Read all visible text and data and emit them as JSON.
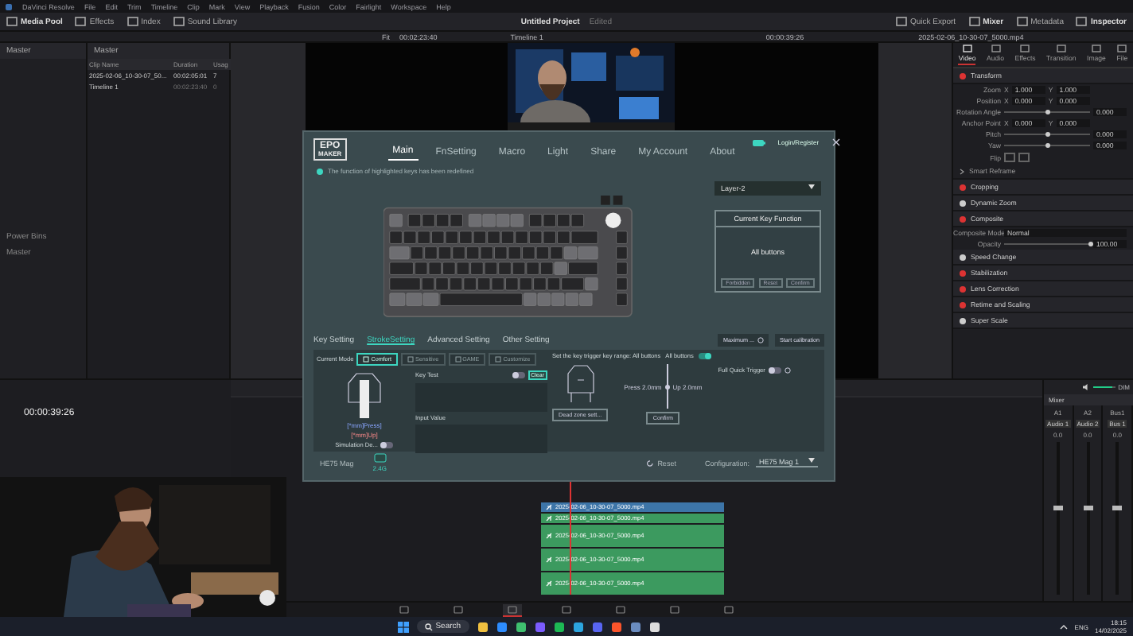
{
  "menubar": {
    "items": [
      "DaVinci Resolve",
      "File",
      "Edit",
      "Trim",
      "Timeline",
      "Clip",
      "Mark",
      "View",
      "Playback",
      "Fusion",
      "Color",
      "Fairlight",
      "Workspace",
      "Help"
    ]
  },
  "toolbar": {
    "left": [
      "Media Pool",
      "Effects",
      "Index",
      "Sound Library"
    ],
    "project": "Untitled Project",
    "project_state": "Edited",
    "right": [
      "Quick Export",
      "Mixer",
      "Metadata",
      "Inspector"
    ]
  },
  "viewer_bar": {
    "zoom": "Fit",
    "source_timecode": "00:02:23:40",
    "timeline": "Timeline 1",
    "timecode": "00:00:39:26",
    "clip": "2025-02-06_10-30-07_5000.mp4"
  },
  "bins": {
    "header": "Master",
    "power_bins": "Power Bins",
    "items": [
      "Master"
    ]
  },
  "media_pool": {
    "title": "Master",
    "columns": [
      "Clip Name",
      "Duration",
      "Usag"
    ],
    "rows": [
      {
        "kind": "clip",
        "cells": [
          "2025-02-06_10-30-07_50...",
          "00:02:05:01",
          "7"
        ]
      },
      {
        "kind": "timeline",
        "cells": [
          "Timeline 1",
          "00:02:23:40",
          "0"
        ]
      }
    ]
  },
  "inspector": {
    "tabs": [
      {
        "label": "Video",
        "selected": true
      },
      {
        "label": "Audio",
        "selected": false
      },
      {
        "label": "Effects",
        "selected": false
      },
      {
        "label": "Transition",
        "selected": false
      },
      {
        "label": "Image",
        "selected": false
      },
      {
        "label": "File",
        "selected": false
      }
    ],
    "sections": [
      {
        "kind": "section",
        "title": "Transform",
        "enabled": true,
        "rows": [
          {
            "kind": "pair",
            "label": "Zoom",
            "fields": [
              {
                "axis": "X",
                "value": "1.000"
              },
              {
                "axis": "Y",
                "value": "1.000"
              }
            ]
          },
          {
            "kind": "pair",
            "label": "Position",
            "fields": [
              {
                "axis": "X",
                "value": "0.000"
              },
              {
                "axis": "Y",
                "value": "0.000"
              }
            ]
          },
          {
            "kind": "slider",
            "label": "Rotation Angle",
            "value": "0.000",
            "level": 0.5
          },
          {
            "kind": "pair",
            "label": "Anchor Point",
            "fields": [
              {
                "axis": "X",
                "value": "0.000"
              },
              {
                "axis": "Y",
                "value": "0.000"
              }
            ]
          },
          {
            "kind": "slider",
            "label": "Pitch",
            "value": "0.000",
            "level": 0.5
          },
          {
            "kind": "slider",
            "label": "Yaw",
            "value": "0.000",
            "level": 0.5
          },
          {
            "kind": "flip",
            "label": "Flip"
          }
        ]
      },
      {
        "kind": "subsection",
        "title": "Smart Reframe"
      },
      {
        "kind": "section",
        "title": "Cropping",
        "enabled": true
      },
      {
        "kind": "section",
        "title": "Dynamic Zoom",
        "enabled": false
      },
      {
        "kind": "section",
        "title": "Composite",
        "enabled": true,
        "rows": [
          {
            "kind": "select",
            "label": "Composite Mode",
            "value": "Normal"
          },
          {
            "kind": "slider",
            "label": "Opacity",
            "value": "100.00",
            "level": 1
          }
        ]
      },
      {
        "kind": "section",
        "title": "Speed Change",
        "enabled": false
      },
      {
        "kind": "section",
        "title": "Stabilization",
        "enabled": true
      },
      {
        "kind": "section",
        "title": "Lens Correction",
        "enabled": true
      },
      {
        "kind": "section",
        "title": "Retime and Scaling",
        "enabled": true
      },
      {
        "kind": "section",
        "title": "Super Scale",
        "enabled": false
      }
    ]
  },
  "timeline": {
    "timecode": "00:00:39:26",
    "clips": [
      {
        "kind": "video",
        "name": "2025-02-06_10-30-07_5000.mp4",
        "tall": false
      },
      {
        "kind": "audio",
        "name": "2025-02-06_10-30-07_5000.mp4",
        "tall": false
      },
      {
        "kind": "audio",
        "name": "2025-02-06_10-30-07_5000.mp4",
        "tall": true
      },
      {
        "kind": "audio",
        "name": "2025-02-06_10-30-07_5000.mp4",
        "tall": true
      },
      {
        "kind": "audio",
        "name": "2025-02-06_10-30-07_5000.mp4",
        "tall": true
      }
    ]
  },
  "mixer": {
    "title": "Mixer",
    "dim": "DIM",
    "volume": {
      "level": 0.85
    },
    "channels": [
      {
        "name": "A1",
        "strip": "Audio 1",
        "reading": "0.0",
        "level": 0.55
      },
      {
        "name": "A2",
        "strip": "Audio 2",
        "reading": "0.0",
        "level": 0.55
      },
      {
        "name": "Bus1",
        "strip": "Bus 1",
        "reading": "0.0",
        "level": 0.55
      }
    ]
  },
  "device_app": {
    "logo": [
      "EPO",
      "MAKER"
    ],
    "tabs": [
      {
        "label": "Main",
        "selected": true
      },
      {
        "label": "FnSetting",
        "selected": false
      },
      {
        "label": "Macro",
        "selected": false
      },
      {
        "label": "Light",
        "selected": false
      },
      {
        "label": "Share",
        "selected": false
      },
      {
        "label": "My Account",
        "selected": false
      },
      {
        "label": "About",
        "selected": false
      }
    ],
    "account": "Login/Register",
    "notice": "The function of highlighted keys has been redefined",
    "layer": "Layer-2",
    "key_function": {
      "title": "Current Key Function",
      "value": "All buttons",
      "buttons": [
        "Forbidden",
        "Reset",
        "Confirm"
      ]
    },
    "subtabs": [
      {
        "label": "Key Setting",
        "selected": false
      },
      {
        "label": "StrokeSetting",
        "selected": true
      },
      {
        "label": "Advanced Setting",
        "selected": false
      },
      {
        "label": "Other Setting",
        "selected": false
      }
    ],
    "calibration": {
      "mode": "Maximum ...",
      "button": "Start calibration"
    },
    "stroke": {
      "mode_label": "Current Mode",
      "modes": [
        {
          "label": "Comfort",
          "selected": true
        },
        {
          "label": "Sensitive",
          "selected": false
        },
        {
          "label": "GAME",
          "selected": false
        },
        {
          "label": "Customize",
          "selected": false
        }
      ],
      "range": "Set the key trigger key range: All buttons",
      "all_buttons": {
        "label": "All buttons",
        "on": true
      },
      "key_test": {
        "label": "Key Test",
        "on": false,
        "clear": "Clear"
      },
      "input_label": "Input Value",
      "switch_labels": [
        "[*mm]Press]",
        "[*mm]Up]"
      ],
      "simulation": {
        "label": "Simulation De...",
        "on": false
      },
      "travel": {
        "labels": [
          "Press 2.0mm",
          "Up 2.0mm"
        ],
        "level": 0.5
      },
      "dead_zone": "Dead zone sett...",
      "confirm": "Confirm",
      "full_quick_trigger": {
        "label": "Full Quick Trigger",
        "on": false
      }
    },
    "footer": {
      "device": "HE75 Mag",
      "connection": "2.4G",
      "reset": "Reset",
      "configuration_label": "Configuration:",
      "configuration": "HE75 Mag 1"
    }
  },
  "taskbar": {
    "search": "Search",
    "language": "ENG",
    "time": "18:15",
    "date": "14/02/2025"
  }
}
